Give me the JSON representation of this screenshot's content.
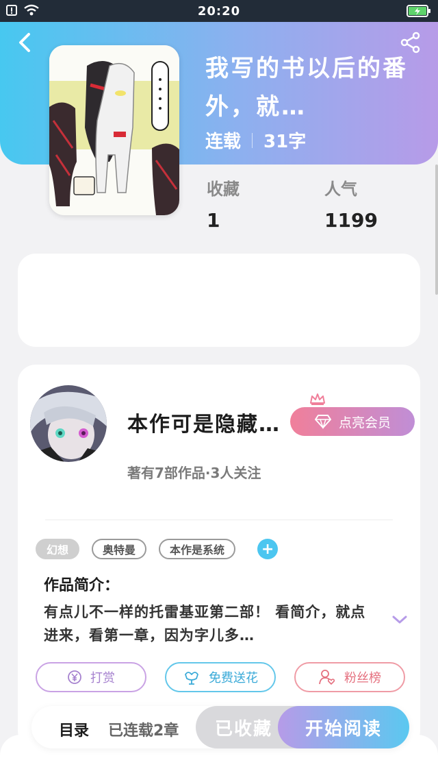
{
  "status_bar": {
    "time": "20:20"
  },
  "book": {
    "title": "我写的书以后的番外，就…",
    "status": "连载",
    "word_count": "31字"
  },
  "stats": [
    {
      "label": "收藏",
      "value": "1"
    },
    {
      "label": "人气",
      "value": "1199"
    }
  ],
  "author": {
    "name": "本作可是隐藏…",
    "summary": "著有7部作品·3人关注",
    "vip_label": "点亮会员"
  },
  "tags": [
    "幻想",
    "奥特曼",
    "本作是系统"
  ],
  "intro": {
    "heading": "作品简介：",
    "text": "有点儿不一样的托雷基亚第二部！ 看简介，就点进来，看第一章，因为字儿多…"
  },
  "actions": {
    "reward": "打赏",
    "flower": "免费送花",
    "fans": "粉丝榜"
  },
  "bottom_bar": {
    "toc": "目录",
    "chapters": "已连载2章",
    "collected": "已收藏",
    "start": "开始阅读"
  }
}
